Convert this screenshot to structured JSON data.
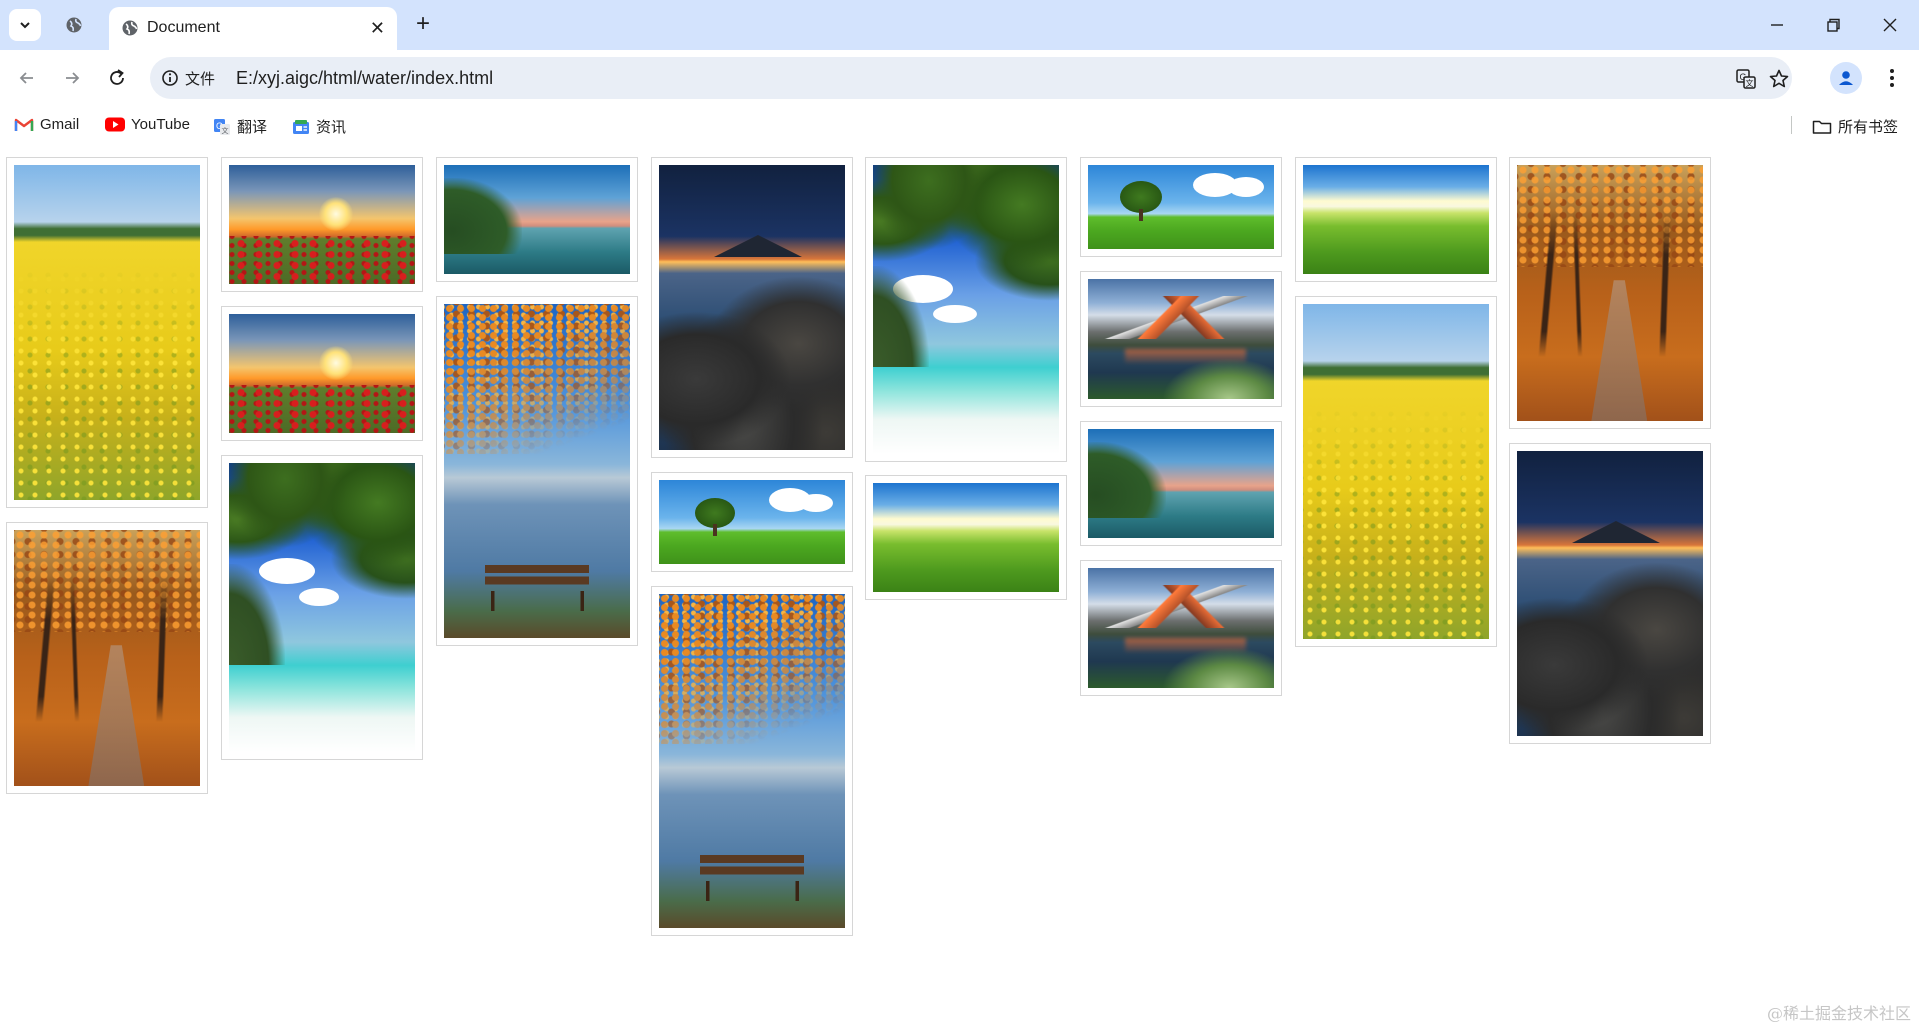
{
  "browser": {
    "tab": {
      "title": "Document"
    },
    "address": {
      "security_label": "文件",
      "url": "E:/xyj.aigc/html/water/index.html"
    },
    "bookmarks": [
      {
        "label": "Gmail",
        "icon": "gmail-icon"
      },
      {
        "label": "YouTube",
        "icon": "youtube-icon"
      },
      {
        "label": "翻译",
        "icon": "google-translate-icon"
      },
      {
        "label": "资讯",
        "icon": "news-icon"
      }
    ],
    "all_bookmarks_label": "所有书签"
  },
  "gallery": {
    "columns": [
      [
        "canola-field",
        "autumn-path"
      ],
      [
        "sunset-poppies",
        "sunset-poppies",
        "leaf-beach"
      ],
      [
        "lake-dawn",
        "autumn-bench"
      ],
      [
        "night-sea-rocks",
        "tree-meadow",
        "autumn-bench"
      ],
      [
        "leaf-beach",
        "green-field"
      ],
      [
        "tree-meadow",
        "mountain-lake",
        "lake-dawn",
        "mountain-lake"
      ],
      [
        "green-field",
        "canola-field"
      ],
      [
        "autumn-path",
        "night-sea-rocks"
      ]
    ]
  },
  "watermark": "@稀土掘金技术社区",
  "colors": {
    "titlebar": "#d3e3fd",
    "omnibox": "#e9eef6",
    "card_border": "#d6d6d6"
  }
}
